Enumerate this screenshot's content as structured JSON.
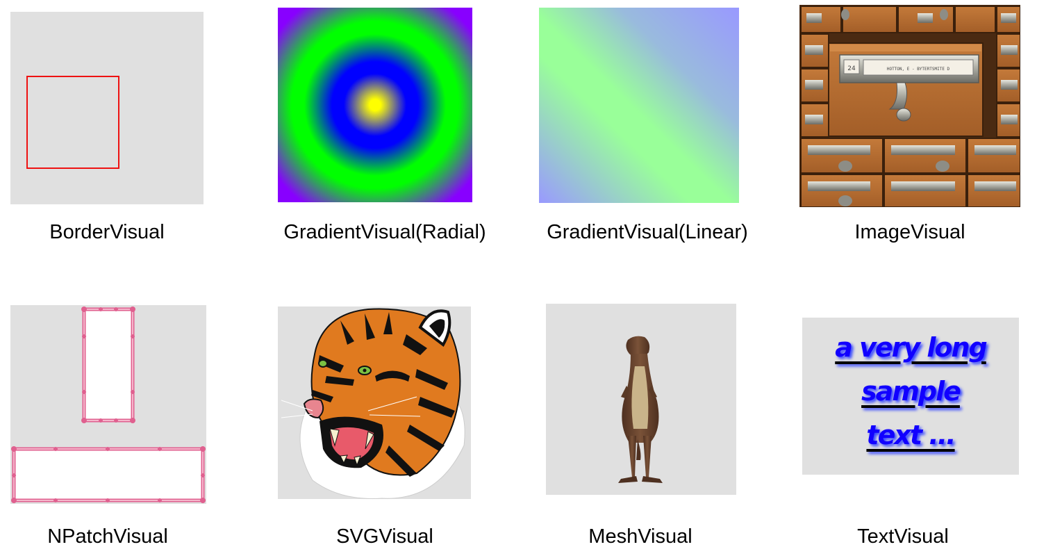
{
  "visuals": [
    {
      "id": "border",
      "caption": "BorderVisual",
      "border_color": "#ee1111",
      "background": "#e0e0e0"
    },
    {
      "id": "radial",
      "caption": "GradientVisual(Radial)",
      "colors": [
        "#ffff00",
        "#0000ff",
        "#00ff00",
        "#8800ff"
      ]
    },
    {
      "id": "linear",
      "caption": "GradientVisual(Linear)",
      "colors": [
        "#9999ff",
        "#99ff99",
        "#9999ff"
      ]
    },
    {
      "id": "image",
      "caption": "ImageVisual",
      "drawer_label": "HOTTON, E - BYTERTSMITE D",
      "drawer_number": "24"
    },
    {
      "id": "npatch",
      "caption": "NPatchVisual",
      "frame_color": "#e0608f"
    },
    {
      "id": "svg",
      "caption": "SVGVisual",
      "subject": "tiger"
    },
    {
      "id": "mesh",
      "caption": "MeshVisual",
      "subject": "dinosaur"
    },
    {
      "id": "text",
      "caption": "TextVisual",
      "text_line1": "a very long sample",
      "text_line2": "text ...",
      "text_color": "#1100ff"
    }
  ]
}
